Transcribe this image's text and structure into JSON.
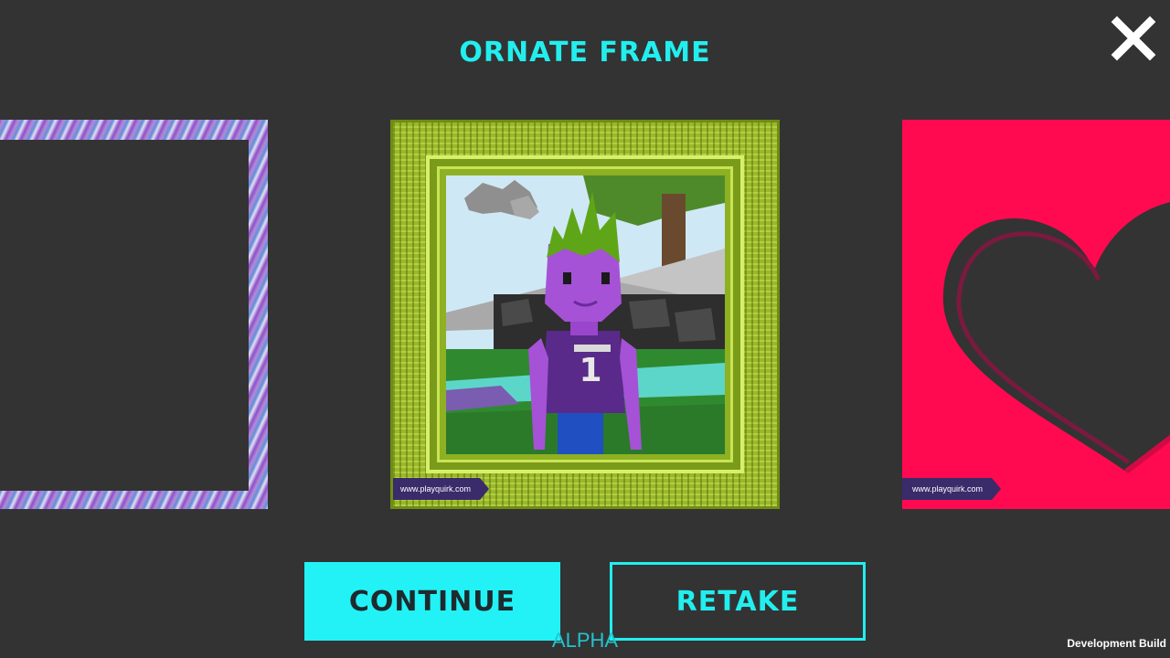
{
  "header": {
    "title": "ORNATE FRAME",
    "close_icon": "close-icon"
  },
  "frames": {
    "left": {
      "style": "purple-brush-frame"
    },
    "center": {
      "style": "ornate-gold-frame",
      "watermark": "www.playquirk.com",
      "jersey_number": "1"
    },
    "right": {
      "style": "pink-heart-frame",
      "watermark": "www.playquirk.com"
    }
  },
  "buttons": {
    "continue_label": "CONTINUE",
    "retake_label": "RETAKE"
  },
  "footer": {
    "alpha_label": "ALPHA",
    "build_label": "Development Build"
  },
  "colors": {
    "background": "#333333",
    "accent": "#22eeee",
    "frame_green": "#9ab829",
    "frame_pink": "#ff0a50"
  }
}
